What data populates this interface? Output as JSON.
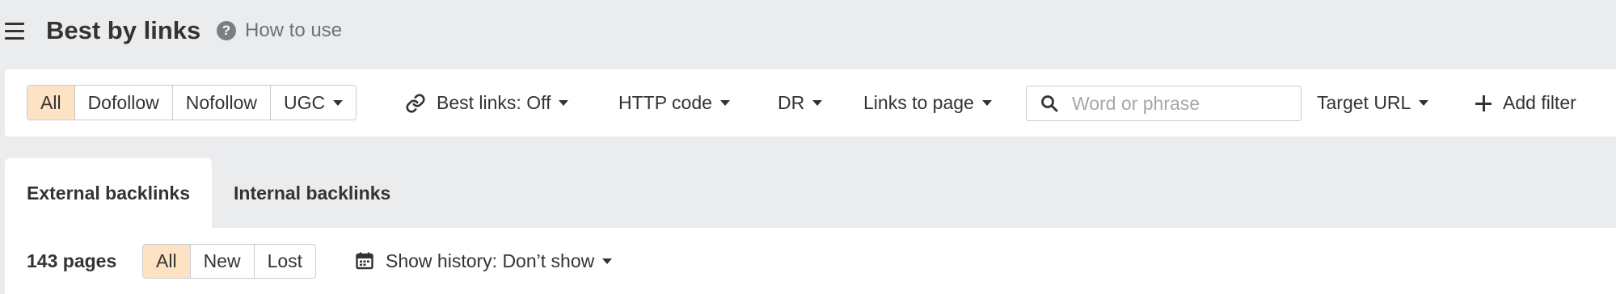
{
  "header": {
    "title": "Best by links",
    "how_to_use": "How to use"
  },
  "filters": {
    "link_type": {
      "options": [
        "All",
        "Dofollow",
        "Nofollow",
        "UGC"
      ],
      "selected": "All"
    },
    "best_links": "Best links: Off",
    "http_code": "HTTP code",
    "dr": "DR",
    "links_to_page": "Links to page",
    "search": {
      "placeholder": "Word or phrase",
      "value": ""
    },
    "target_url": "Target URL",
    "add_filter": "Add filter"
  },
  "tabs": [
    {
      "label": "External backlinks",
      "active": true
    },
    {
      "label": "Internal backlinks",
      "active": false
    }
  ],
  "results": {
    "count": "143 pages",
    "status": {
      "options": [
        "All",
        "New",
        "Lost"
      ],
      "selected": "All"
    },
    "show_history": "Show history: Don’t show"
  },
  "colors": {
    "background": "#ebecee",
    "active_segment": "#fde3c4",
    "border": "#c9ccd1"
  }
}
